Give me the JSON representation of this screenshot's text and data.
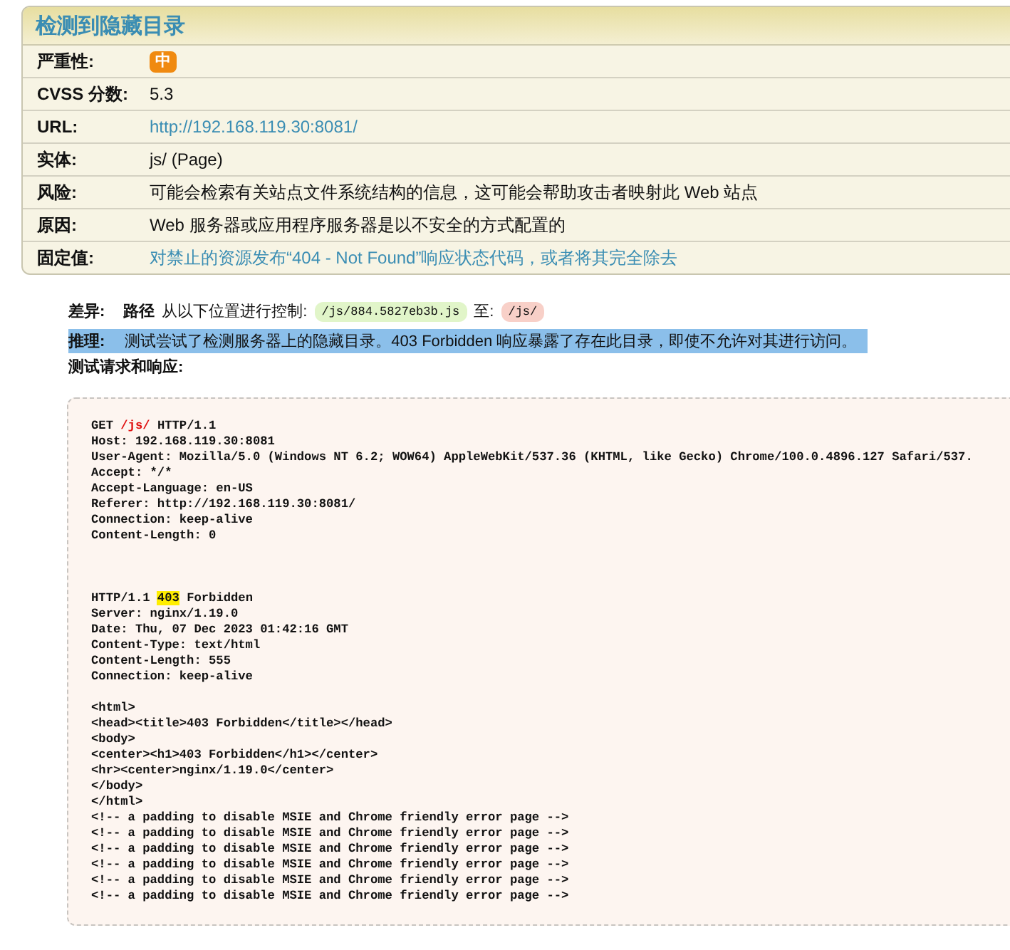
{
  "issue": {
    "title": "检测到隐藏目录",
    "fields": [
      {
        "label": "严重性:",
        "kind": "badge",
        "value": "中"
      },
      {
        "label": "CVSS 分数:",
        "kind": "text",
        "value": "5.3"
      },
      {
        "label": "URL:",
        "kind": "link",
        "value": "http://192.168.119.30:8081/"
      },
      {
        "label": "实体:",
        "kind": "text",
        "value": "js/ (Page)"
      },
      {
        "label": "风险:",
        "kind": "text",
        "value": "可能会检索有关站点文件系统结构的信息，这可能会帮助攻击者映射此 Web 站点"
      },
      {
        "label": "原因:",
        "kind": "text",
        "value": "Web 服务器或应用程序服务器是以不安全的方式配置的"
      },
      {
        "label": "固定值:",
        "kind": "link",
        "value": "对禁止的资源发布“404 - Not Found”响应状态代码，或者将其完全除去"
      }
    ]
  },
  "diff": {
    "label": "差异:",
    "field": "路径",
    "from_text": "从以下位置进行控制:",
    "from_value": "/js/884.5827eb3b.js",
    "to_text": "至:",
    "to_value": "/js/"
  },
  "reasoning": {
    "label": "推理:",
    "text": "测试尝试了检测服务器上的隐藏目录。403 Forbidden 响应暴露了存在此目录，即使不允许对其进行访问。",
    "highlighted": true
  },
  "test_heading": "测试请求和响应:",
  "code_blocks": [
    {
      "lines": [
        {
          "parts": [
            {
              "kind": "plain",
              "text": "GET "
            },
            {
              "kind": "path",
              "text": "/js/"
            },
            {
              "kind": "plain",
              "text": " HTTP/1.1"
            }
          ]
        },
        {
          "parts": [
            {
              "kind": "plain",
              "text": "Host: 192.168.119.30:8081"
            }
          ]
        },
        {
          "parts": [
            {
              "kind": "plain",
              "text": "User-Agent: Mozilla/5.0 (Windows NT 6.2; WOW64) AppleWebKit/537.36 (KHTML, like Gecko) Chrome/100.0.4896.127 Safari/537."
            }
          ]
        },
        {
          "parts": [
            {
              "kind": "plain",
              "text": "Accept: */*"
            }
          ]
        },
        {
          "parts": [
            {
              "kind": "plain",
              "text": "Accept-Language: en-US"
            }
          ]
        },
        {
          "parts": [
            {
              "kind": "plain",
              "text": "Referer: http://192.168.119.30:8081/"
            }
          ]
        },
        {
          "parts": [
            {
              "kind": "plain",
              "text": "Connection: keep-alive"
            }
          ]
        },
        {
          "parts": [
            {
              "kind": "plain",
              "text": "Content-Length: 0"
            }
          ]
        }
      ]
    },
    {
      "lines": [
        {
          "parts": [
            {
              "kind": "plain",
              "text": "HTTP/1.1 "
            },
            {
              "kind": "status",
              "text": "403"
            },
            {
              "kind": "plain",
              "text": " Forbidden"
            }
          ]
        },
        {
          "parts": [
            {
              "kind": "plain",
              "text": "Server: nginx/1.19.0"
            }
          ]
        },
        {
          "parts": [
            {
              "kind": "plain",
              "text": "Date: Thu, 07 Dec 2023 01:42:16 GMT"
            }
          ]
        },
        {
          "parts": [
            {
              "kind": "plain",
              "text": "Content-Type: text/html"
            }
          ]
        },
        {
          "parts": [
            {
              "kind": "plain",
              "text": "Content-Length: 555"
            }
          ]
        },
        {
          "parts": [
            {
              "kind": "plain",
              "text": "Connection: keep-alive"
            }
          ]
        }
      ]
    },
    {
      "lines": [
        {
          "parts": [
            {
              "kind": "plain",
              "text": "<html>"
            }
          ]
        },
        {
          "parts": [
            {
              "kind": "plain",
              "text": "<head><title>403 Forbidden</title></head>"
            }
          ]
        },
        {
          "parts": [
            {
              "kind": "plain",
              "text": "<body>"
            }
          ]
        },
        {
          "parts": [
            {
              "kind": "plain",
              "text": "<center><h1>403 Forbidden</h1></center>"
            }
          ]
        },
        {
          "parts": [
            {
              "kind": "plain",
              "text": "<hr><center>nginx/1.19.0</center>"
            }
          ]
        },
        {
          "parts": [
            {
              "kind": "plain",
              "text": "</body>"
            }
          ]
        },
        {
          "parts": [
            {
              "kind": "plain",
              "text": "</html>"
            }
          ]
        },
        {
          "parts": [
            {
              "kind": "plain",
              "text": "<!-- a padding to disable MSIE and Chrome friendly error page -->"
            }
          ]
        },
        {
          "parts": [
            {
              "kind": "plain",
              "text": "<!-- a padding to disable MSIE and Chrome friendly error page -->"
            }
          ]
        },
        {
          "parts": [
            {
              "kind": "plain",
              "text": "<!-- a padding to disable MSIE and Chrome friendly error page -->"
            }
          ]
        },
        {
          "parts": [
            {
              "kind": "plain",
              "text": "<!-- a padding to disable MSIE and Chrome friendly error page -->"
            }
          ]
        },
        {
          "parts": [
            {
              "kind": "plain",
              "text": "<!-- a padding to disable MSIE and Chrome friendly error page -->"
            }
          ]
        },
        {
          "parts": [
            {
              "kind": "plain",
              "text": "<!-- a padding to disable MSIE and Chrome friendly error page -->"
            }
          ]
        }
      ]
    }
  ]
}
